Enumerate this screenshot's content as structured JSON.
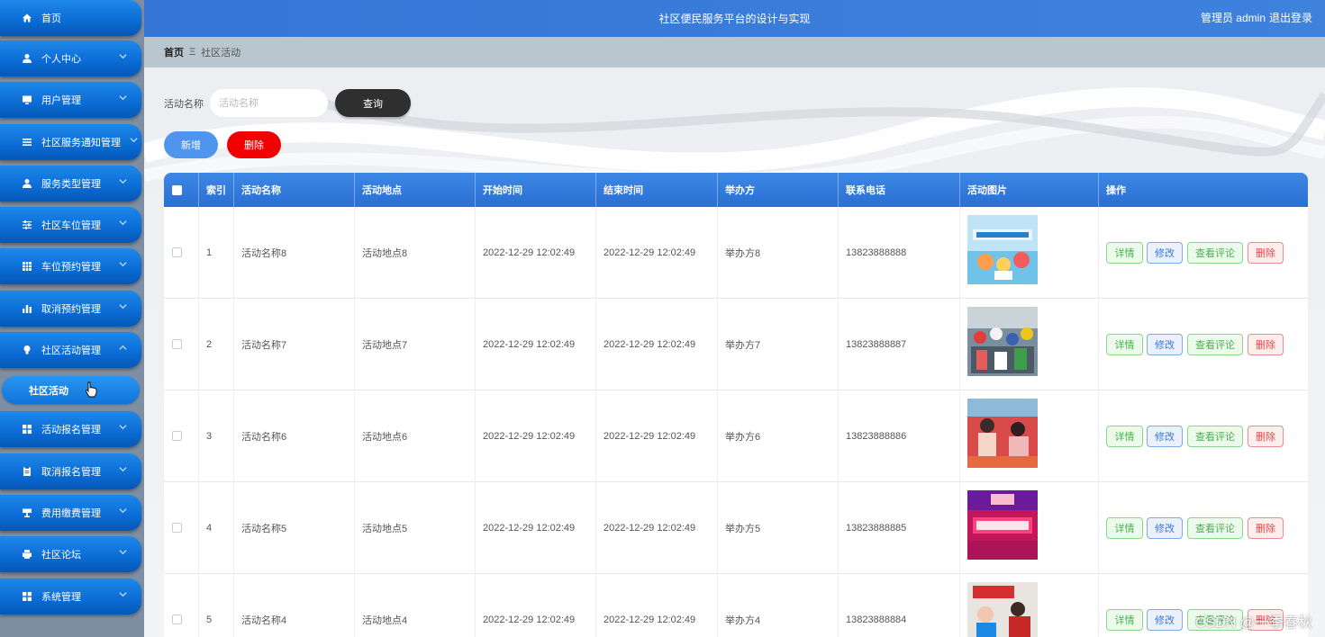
{
  "app": {
    "title": "社区便民服务平台的设计与实现",
    "user": "管理员 admin",
    "logout": "退出登录"
  },
  "sidebar": {
    "items": [
      {
        "label": "首页",
        "icon": "home-icon"
      },
      {
        "label": "个人中心",
        "icon": "user-icon"
      },
      {
        "label": "用户管理",
        "icon": "monitor-icon"
      },
      {
        "label": "社区服务通知管理",
        "icon": "list-icon"
      },
      {
        "label": "服务类型管理",
        "icon": "user-icon"
      },
      {
        "label": "社区车位管理",
        "icon": "sliders-icon"
      },
      {
        "label": "车位预约管理",
        "icon": "grid-icon"
      },
      {
        "label": "取消预约管理",
        "icon": "bar-chart-icon"
      },
      {
        "label": "社区活动管理",
        "icon": "bulb-icon"
      },
      {
        "label": "活动报名管理",
        "icon": "apps-icon"
      },
      {
        "label": "取消报名管理",
        "icon": "clipboard-icon"
      },
      {
        "label": "费用缴费管理",
        "icon": "cup-icon"
      },
      {
        "label": "社区论坛",
        "icon": "printer-icon"
      },
      {
        "label": "系统管理",
        "icon": "apps-icon"
      }
    ],
    "active_sub": "社区活动"
  },
  "breadcrumb": {
    "home": "首页",
    "separator": "Ξ",
    "current": "社区活动"
  },
  "search": {
    "label": "活动名称",
    "placeholder": "活动名称",
    "button": "查询"
  },
  "actions": {
    "add": "新增",
    "delete": "删除"
  },
  "table": {
    "columns": [
      "索引",
      "活动名称",
      "活动地点",
      "开始时间",
      "结束时间",
      "举办方",
      "联系电话",
      "活动图片",
      "操作"
    ],
    "op_labels": {
      "detail": "详情",
      "edit": "修改",
      "comments": "查看评论",
      "delete": "删除"
    },
    "rows": [
      {
        "index": "1",
        "name": "活动名称8",
        "place": "活动地点8",
        "start": "2022-12-29 12:02:49",
        "end": "2022-12-29 12:02:49",
        "host": "举办方8",
        "phone": "13823888888"
      },
      {
        "index": "2",
        "name": "活动名称7",
        "place": "活动地点7",
        "start": "2022-12-29 12:02:49",
        "end": "2022-12-29 12:02:49",
        "host": "举办方7",
        "phone": "13823888887"
      },
      {
        "index": "3",
        "name": "活动名称6",
        "place": "活动地点6",
        "start": "2022-12-29 12:02:49",
        "end": "2022-12-29 12:02:49",
        "host": "举办方6",
        "phone": "13823888886"
      },
      {
        "index": "4",
        "name": "活动名称5",
        "place": "活动地点5",
        "start": "2022-12-29 12:02:49",
        "end": "2022-12-29 12:02:49",
        "host": "举办方5",
        "phone": "13823888885"
      },
      {
        "index": "5",
        "name": "活动名称4",
        "place": "活动地点4",
        "start": "2022-12-29 12:02:49",
        "end": "2022-12-29 12:02:49",
        "host": "举办方4",
        "phone": "13823888884"
      }
    ]
  },
  "watermark": "CSDN @一季春秋",
  "colors": {
    "sidebar_blue": "#0a6bd4",
    "topbar": "#3a7bd9",
    "danger": "#f00000",
    "primary": "#4f95ee"
  }
}
